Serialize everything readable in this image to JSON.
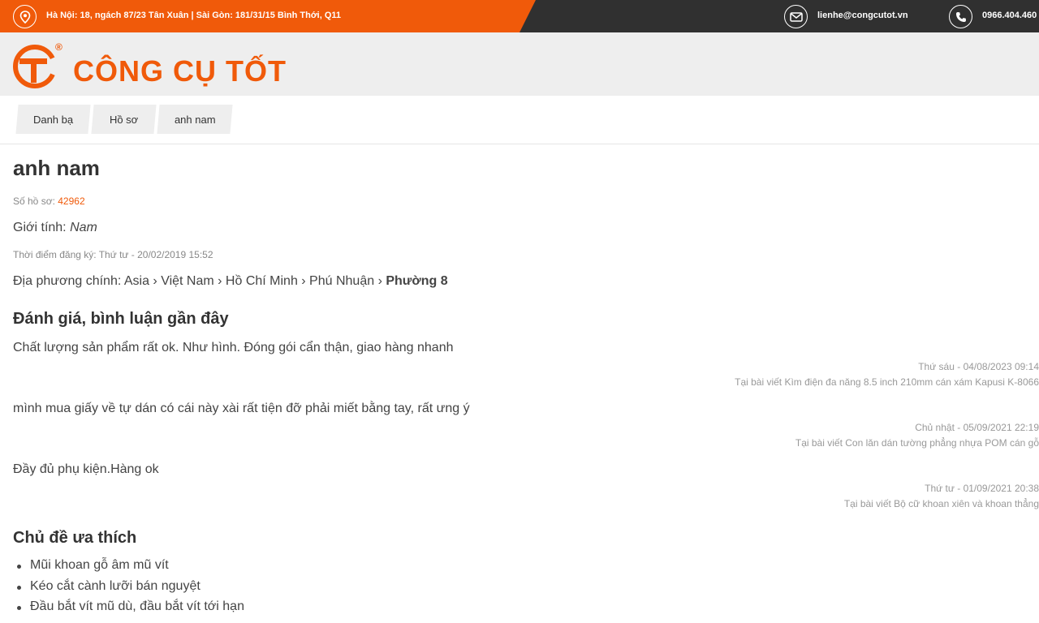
{
  "topbar": {
    "address": "Hà Nội: 18, ngách 87/23 Tân Xuân | Sài Gòn: 181/31/15 Bình Thới, Q11",
    "email": "lienhe@congcutot.vn",
    "phone": "0966.404.460",
    "icons": [
      "map-pin-icon",
      "mail-icon",
      "phone-icon"
    ]
  },
  "brand": {
    "name": "CÔNG CỤ TỐT",
    "registered": "®",
    "color": "#f05a0a"
  },
  "breadcrumb": [
    "Danh bạ",
    "Hồ sơ",
    "anh nam"
  ],
  "profile": {
    "name": "anh nam",
    "id_label": "Số hồ sơ:",
    "id_value": "42962",
    "gender_label": "Giới tính:",
    "gender_value": "Nam",
    "registered": "Thời điểm đăng ký: Thứ tư - 20/02/2019 15:52",
    "location_label": "Địa phương chính:",
    "location_path": "Asia › Việt Nam › Hồ Chí Minh › Phú Nhuận ›",
    "location_last": "Phường 8"
  },
  "reviews": {
    "title": "Đánh giá, bình luận gần đây",
    "items": [
      {
        "text": "Chất lượng sản phẩm rất ok. Như hình. Đóng gói cẩn thận, giao hàng nhanh",
        "date": "Thứ sáu - 04/08/2023 09:14",
        "article": "Tại bài viết Kìm điện đa năng 8.5 inch 210mm cán xám Kapusi K-8066"
      },
      {
        "text": "mình mua giấy về tự dán có cái này xài rất tiện đỡ phải miết bằng tay, rất ưng ý",
        "date": "Chủ nhật - 05/09/2021 22:19",
        "article": "Tại bài viết Con lăn dán tường phẳng nhựa POM cán gỗ"
      },
      {
        "text": "Đầy đủ phụ kiện.Hàng ok",
        "date": "Thứ tư - 01/09/2021 20:38",
        "article": "Tại bài viết Bộ cữ khoan xiên và khoan thẳng"
      }
    ]
  },
  "topics": {
    "title": "Chủ đề ưa thích",
    "items": [
      "Mũi khoan gỗ âm mũ vít",
      "Kéo cắt cành lưỡi bán nguyệt",
      "Đầu bắt vít mũ dù, đầu bắt vít tới hạn"
    ]
  }
}
